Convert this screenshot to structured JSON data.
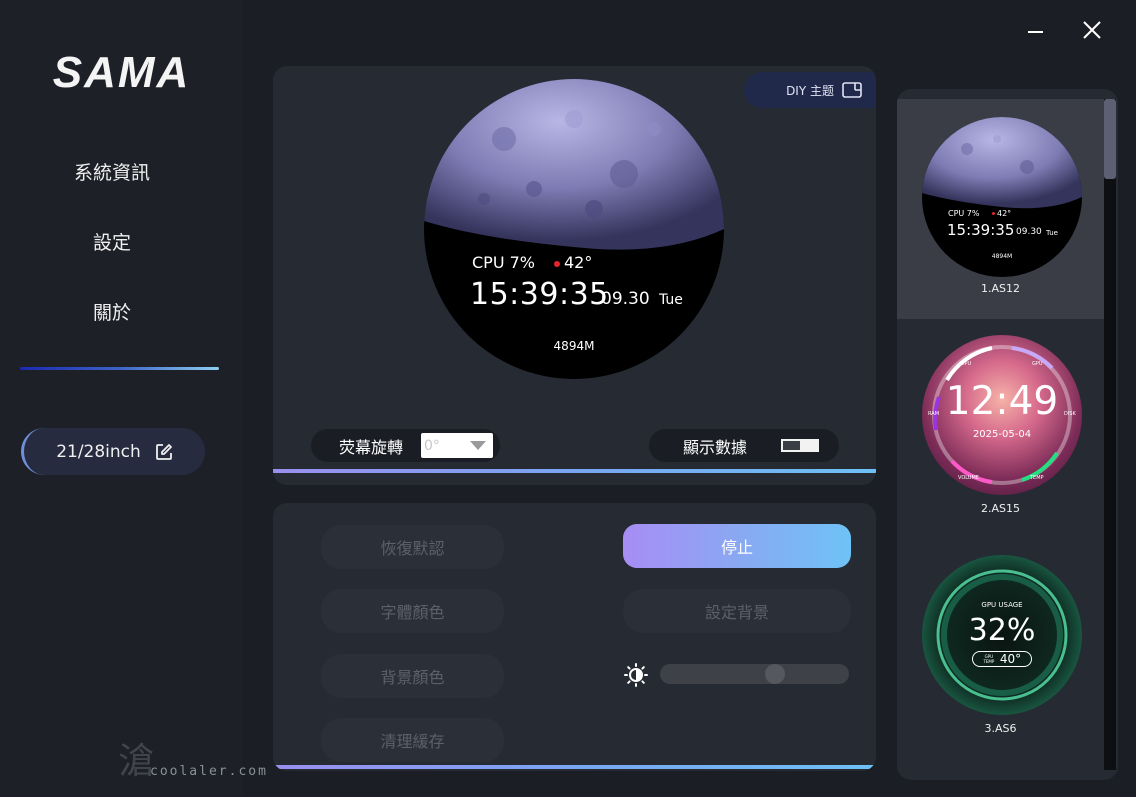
{
  "brand": {
    "logo": "SAMA"
  },
  "nav": {
    "items": [
      {
        "label": "系統資訊"
      },
      {
        "label": "設定"
      },
      {
        "label": "關於"
      }
    ]
  },
  "device": {
    "size_label": "21/28inch"
  },
  "watermark": {
    "glyph": "滄",
    "text": "coolaler.com"
  },
  "preview": {
    "diy_label": "DIY 主题",
    "dial": {
      "cpu": "CPU 7%",
      "temp": "42°",
      "time": "15:39:35",
      "date": "09.30",
      "day": "Tue",
      "memory": "4894M"
    },
    "rotation_label": "荧幕旋轉",
    "rotation_value": "0°",
    "show_data_label": "顯示數據"
  },
  "controls": {
    "restore_default": "恢復默認",
    "stop": "停止",
    "font_color": "字體顏色",
    "set_background": "設定背景",
    "bg_color": "背景顏色",
    "clear_cache": "清理緩存",
    "brightness": 0.62
  },
  "themes": [
    {
      "name": "1.AS12",
      "cpu": "CPU 7%",
      "temp": "42°",
      "time": "15:39:35",
      "date": "09.30",
      "day": "Tue",
      "memory": "4894M"
    },
    {
      "name": "2.AS15",
      "time": "12:49",
      "date": "2025-05-04",
      "gauges": [
        "CPU",
        "GPU",
        "DISK",
        "RAM",
        "VOLUME",
        "TEMP"
      ]
    },
    {
      "name": "3.AS6",
      "title": "GPU USAGE",
      "value": "32%",
      "sub_label": "GPU TEMP",
      "sub_value": "40°"
    }
  ],
  "colors": {
    "accent_start": "#a78df5",
    "accent_end": "#6ec2f6",
    "temp_dot": "#e2262b"
  }
}
